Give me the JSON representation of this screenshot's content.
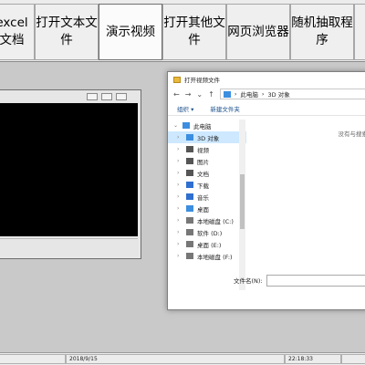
{
  "toolbar": {
    "buttons": [
      {
        "line1": "excel",
        "line2": "文档"
      },
      {
        "line1": "打开文本文",
        "line2": "件"
      },
      {
        "line1": "演示视频",
        "line2": ""
      },
      {
        "line1": "打开其他文",
        "line2": "件"
      },
      {
        "line1": "网页浏览器",
        "line2": ""
      },
      {
        "line1": "随机抽取程",
        "line2": "序"
      }
    ]
  },
  "dialog": {
    "title": "打开视频文件",
    "path_root": "此电脑",
    "path_leaf": "3D 对象",
    "organize": "组织 ▾",
    "new_folder": "新建文件夹",
    "empty_message": "没有与搜索",
    "filename_label": "文件名(N):",
    "tree": [
      {
        "label": "此电脑",
        "level": 0,
        "icon_color": "#3c8ee0"
      },
      {
        "label": "3D 对象",
        "level": 1,
        "icon_color": "#3c8ee0",
        "selected": true
      },
      {
        "label": "视频",
        "level": 1,
        "icon_color": "#555555"
      },
      {
        "label": "图片",
        "level": 1,
        "icon_color": "#555555"
      },
      {
        "label": "文档",
        "level": 1,
        "icon_color": "#555555"
      },
      {
        "label": "下载",
        "level": 1,
        "icon_color": "#2e6fd0"
      },
      {
        "label": "音乐",
        "level": 1,
        "icon_color": "#2e6fd0"
      },
      {
        "label": "桌面",
        "level": 1,
        "icon_color": "#3c8ee0"
      },
      {
        "label": "本地磁盘 (C:)",
        "level": 1,
        "icon_color": "#777777"
      },
      {
        "label": "软件 (D:)",
        "level": 1,
        "icon_color": "#777777"
      },
      {
        "label": "桌面 (E:)",
        "level": 1,
        "icon_color": "#777777"
      },
      {
        "label": "本地磁盘 (F:)",
        "level": 1,
        "icon_color": "#777777"
      }
    ]
  },
  "statusbar": {
    "date": "2018/9/15",
    "time": "22:18:33"
  }
}
